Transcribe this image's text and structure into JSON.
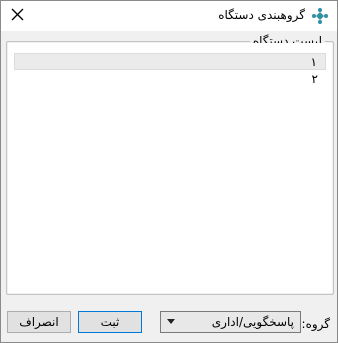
{
  "window": {
    "title": "گروهبندی دستگاه"
  },
  "device_list": {
    "legend": "لیست دستگاه",
    "items": [
      {
        "label": "۱",
        "selected": true
      },
      {
        "label": "۲",
        "selected": false
      }
    ]
  },
  "group": {
    "label": "گروه:",
    "selected_value": "پاسخگویی/اداری"
  },
  "buttons": {
    "submit_label": "ثبت",
    "cancel_label": "انصراف"
  },
  "colors": {
    "accent": "#0078d7",
    "icon": "#2f8fa3"
  },
  "icons": {
    "close": "close-icon",
    "app": "app-icon"
  }
}
